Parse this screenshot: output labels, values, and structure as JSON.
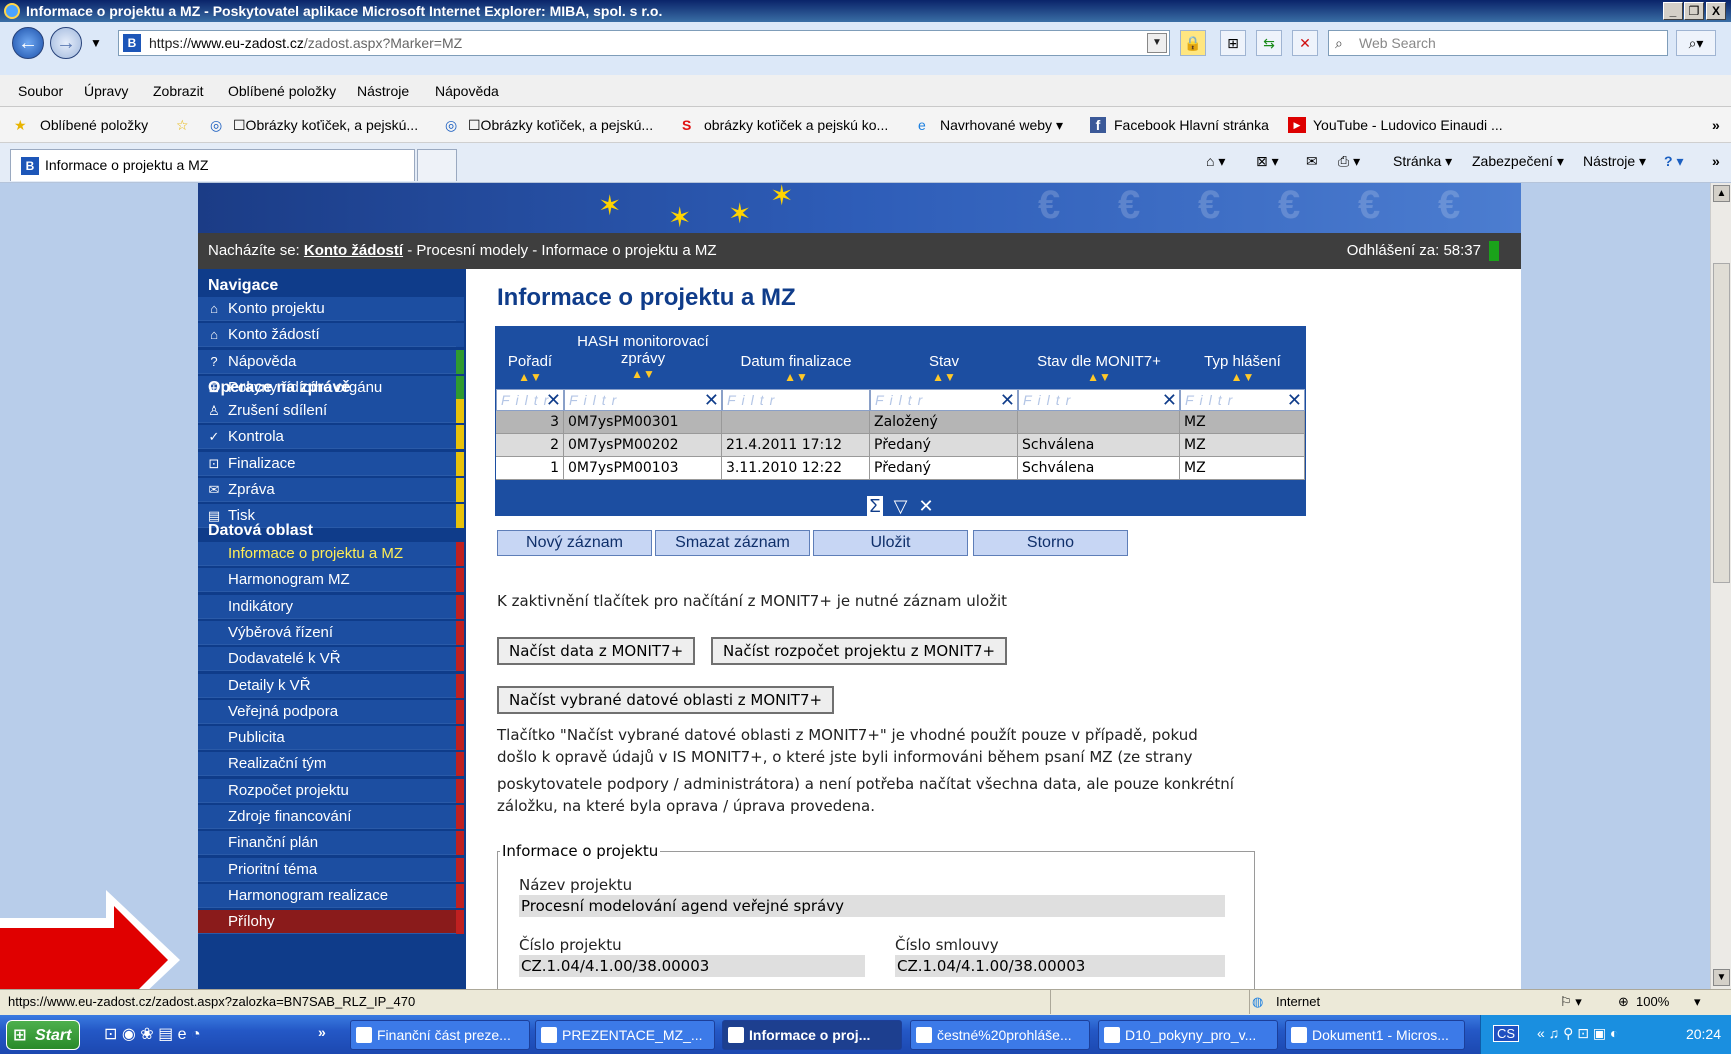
{
  "window": {
    "title": "Informace o projektu a MZ - Poskytovatel aplikace Microsoft Internet Explorer: MIBA, spol. s r.o.",
    "controls": [
      "_",
      "❐",
      "X"
    ]
  },
  "address_bar": {
    "url_prefix": "https://",
    "url_host": "www.eu-zadost.cz",
    "url_path": "/zadost.aspx?Marker=MZ",
    "search_placeholder": "Web Search"
  },
  "menu": [
    "Soubor",
    "Úpravy",
    "Zobrazit",
    "Oblíbené položky",
    "Nástroje",
    "Nápověda"
  ],
  "favorites": {
    "label": "Oblíbené položky",
    "items": [
      "☐Obrázky koťiček, a pejskú...",
      "☐Obrázky koťiček, a pejskú...",
      "obrázky koťiček a pejskú ko...",
      "Navrhované weby ▾",
      "Facebook  Hlavní stránka",
      "YouTube - Ludovico Einaudi ..."
    ]
  },
  "tab": {
    "label": "Informace o projektu a MZ"
  },
  "commandbar": [
    "Stránka ▾",
    "Zabezpečení ▾",
    "Nástroje ▾"
  ],
  "breadcrumb": {
    "prefix": "Nacházíte se:",
    "link": "Konto žádostí",
    "rest": " - Procesní modely - Informace o projektu a MZ",
    "logout": "Odhlášení za: 58:37"
  },
  "nav": {
    "sections": [
      {
        "title": "Navigace",
        "items": [
          {
            "icon": "⌂",
            "label": "Konto projektu",
            "flag": "#1c4ea1"
          },
          {
            "icon": "⌂",
            "label": "Konto žádostí",
            "flag": "#1c4ea1"
          },
          {
            "icon": "?",
            "label": "Nápověda",
            "flag": "#2f9a2f"
          },
          {
            "icon": "⊞",
            "label": "Pokyny řídícího orgánu",
            "flag": "#2f9a2f"
          }
        ]
      },
      {
        "title": "Operace na zprávě",
        "items": [
          {
            "icon": "♙",
            "label": "Zrušení sdílení",
            "flag": "#e8c20a"
          },
          {
            "icon": "✓",
            "label": "Kontrola",
            "flag": "#e8c20a"
          },
          {
            "icon": "⊡",
            "label": "Finalizace",
            "flag": "#e8c20a"
          },
          {
            "icon": "✉",
            "label": "Zpráva",
            "flag": "#e8c20a"
          },
          {
            "icon": "▤",
            "label": "Tisk",
            "flag": "#e8c20a"
          }
        ]
      },
      {
        "title": "Datová oblast",
        "items": [
          {
            "label": "Informace o projektu a MZ",
            "flag": "#c02020",
            "active": true
          },
          {
            "label": "Harmonogram MZ",
            "flag": "#c02020"
          },
          {
            "label": "Indikátory",
            "flag": "#c02020"
          },
          {
            "label": "Výběrová řízení",
            "flag": "#c02020"
          },
          {
            "label": "Dodavatelé k VŘ",
            "flag": "#c02020"
          },
          {
            "label": "Detaily k VŘ",
            "flag": "#c02020"
          },
          {
            "label": "Veřejná podpora",
            "flag": "#c02020"
          },
          {
            "label": "Publicita",
            "flag": "#c02020"
          },
          {
            "label": "Realizační tým",
            "flag": "#c02020"
          },
          {
            "label": "Rozpočet projektu",
            "flag": "#c02020"
          },
          {
            "label": "Zdroje financování",
            "flag": "#c02020"
          },
          {
            "label": "Finanční plán",
            "flag": "#c02020"
          },
          {
            "label": "Prioritní téma",
            "flag": "#c02020"
          },
          {
            "label": "Harmonogram realizace",
            "flag": "#c02020"
          },
          {
            "label": "Přílohy",
            "flag": "#c02020",
            "attach": true
          }
        ]
      }
    ]
  },
  "main": {
    "title": "Informace o projektu a MZ",
    "grid": {
      "columns": [
        "Pořadí",
        "HASH monitorovací zprávy",
        "Datum finalizace",
        "Stav",
        "Stav dle MONIT7+",
        "Typ hlášení"
      ],
      "filter_placeholder": "Filtr",
      "rows": [
        [
          "3",
          "0M7ysPM00301",
          "",
          "Založený",
          "",
          "MZ"
        ],
        [
          "2",
          "0M7ysPM00202",
          "21.4.2011 17:12",
          "Předaný",
          "Schválena",
          "MZ"
        ],
        [
          "1",
          "0M7ysPM00103",
          "3.11.2010 12:22",
          "Předaný",
          "Schválena",
          "MZ"
        ]
      ]
    },
    "buttons": {
      "new": "Nový záznam",
      "delete": "Smazat záznam",
      "save": "Uložit",
      "cancel": "Storno"
    },
    "note": "K zaktivnění tlačítek pro načítání z MONIT7+ je nutné záznam uložit",
    "monit_buttons": {
      "load_data": "Načíst data z MONIT7+",
      "load_budget": "Načíst rozpočet projektu z MONIT7+",
      "load_selected": "Načíst vybrané datové oblasti z MONIT7+"
    },
    "help_lines": [
      "Tlačítko \"Načíst vybrané datové oblasti z MONIT7+\" je vhodné použít pouze v případě, pokud",
      "došlo k opravě údajů v IS MONIT7+, o které jste byli informováni během psaní MZ (ze strany",
      "poskytovatele podpory / administrátora) a není potřeba načítat všechna data, ale pouze konkrétní",
      "záložku, na které byla oprava / úprava provedena."
    ],
    "project_info": {
      "legend": "Informace o projektu",
      "name_label": "Název projektu",
      "name_value": "Procesní modelování agend veřejné správy",
      "number_label": "Číslo projektu",
      "number_value": "CZ.1.04/4.1.00/38.00003",
      "contract_label": "Číslo smlouvy",
      "contract_value": "CZ.1.04/4.1.00/38.00003"
    }
  },
  "statusbar": {
    "url": "https://www.eu-zadost.cz/zadost.aspx?zalozka=BN7SAB_RLZ_IP_470",
    "zone": "Internet",
    "zoom": "100%"
  },
  "taskbar": {
    "start": "Start",
    "tasks": [
      {
        "label": "Finanční část preze...",
        "active": false
      },
      {
        "label": "PREZENTACE_MZ_...",
        "active": false
      },
      {
        "label": "Informace o proj...",
        "active": true
      },
      {
        "label": "čestné%20prohláše...",
        "active": false
      },
      {
        "label": "D10_pokyny_pro_v...",
        "active": false
      },
      {
        "label": "Dokument1 - Micros...",
        "active": false
      }
    ],
    "lang": "CS",
    "clock": "20:24"
  },
  "colors": {
    "nav_bg": "#0f3c8a",
    "accent": "#1c4ea1",
    "arrow": "#e00000"
  }
}
